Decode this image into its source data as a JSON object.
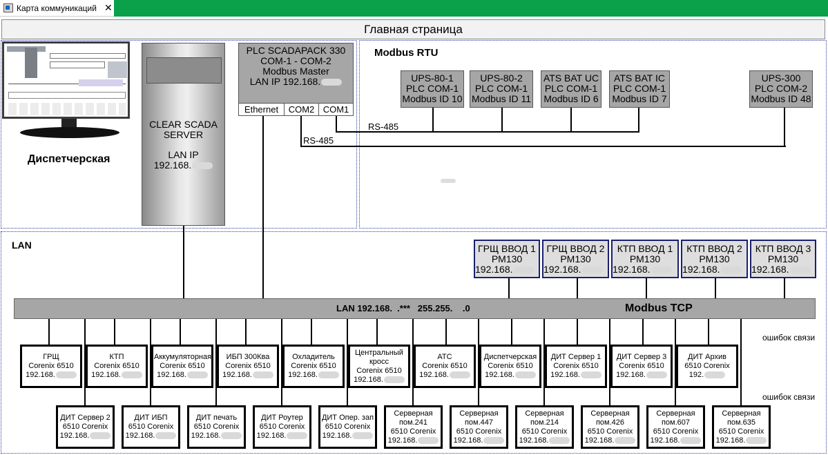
{
  "window": {
    "tab_title": "Карта коммуникаций",
    "close_glyph": "✕"
  },
  "header": {
    "title": "Главная страница"
  },
  "dispatch": {
    "label": "Диспетчерская"
  },
  "server": {
    "line1": "CLEAR SCADA",
    "line2": "SERVER",
    "line3": "LAN IP",
    "ip": "192.168."
  },
  "plc": {
    "line1": "PLC SCADAPACK 330",
    "line2": "COM-1 -  COM-2",
    "line3": "Modbus Master",
    "line4": "LAN IP 192.168.",
    "ports": [
      "Ethernet",
      "COM2",
      "COM1"
    ]
  },
  "rtu": {
    "title": "Modbus RTU",
    "rs485_a": "RS-485",
    "rs485_b": "RS-485",
    "devices": [
      {
        "l1": "UPS-80-1",
        "l2": "PLC COM-1",
        "l3": "Modbus ID 10"
      },
      {
        "l1": "UPS-80-2",
        "l2": "PLC COM-1",
        "l3": "Modbus ID 11"
      },
      {
        "l1": "ATS BAT UC",
        "l2": "PLC COM-1",
        "l3": "Modbus ID 6"
      },
      {
        "l1": "ATS BAT IC",
        "l2": "PLC COM-1",
        "l3": "Modbus ID 7"
      },
      {
        "l1": "UPS-300",
        "l2": "PLC COM-2",
        "l3": "Modbus ID 48"
      }
    ]
  },
  "lan": {
    "title": "LAN",
    "bus_text": "LAN 192.168.  .***   255.255.    .0",
    "bus_tcp": "Modbus TCP",
    "err1": "ошибок связи",
    "err2": "ошибок связи"
  },
  "meters": [
    {
      "l1": "ГРЩ ВВОД 1",
      "l2": "PM130",
      "ip": "192.168."
    },
    {
      "l1": "ГРЩ ВВОД 2",
      "l2": "PM130",
      "ip": "192.168."
    },
    {
      "l1": "КТП ВВОД 1",
      "l2": "PM130",
      "ip": "192.168."
    },
    {
      "l1": "КТП ВВОД 2",
      "l2": "PM130",
      "ip": "192.168."
    },
    {
      "l1": "КТП ВВОД 3",
      "l2": "PM130",
      "ip": "192.168."
    }
  ],
  "row1": [
    {
      "name": "ГРЩ",
      "model": "Corenix 6510",
      "ip": "192.168."
    },
    {
      "name": "КТП",
      "model": "Corenix 6510",
      "ip": "192.168."
    },
    {
      "name": "Аккумуляторная",
      "model": "Corenix 6510",
      "ip": "192.168."
    },
    {
      "name": "ИБП 300Ква",
      "model": "Corenix 6510",
      "ip": "192.168."
    },
    {
      "name": "Охладитель",
      "model": "Corenix 6510",
      "ip": "192.168."
    },
    {
      "name": "Центральный кросс",
      "model": "Corenix 6510",
      "ip": "192.168."
    },
    {
      "name": "АТС",
      "model": "Corenix 6510",
      "ip": "192.168."
    },
    {
      "name": "Диспетчерская",
      "model": "Corenix 6510",
      "ip": "192.168."
    },
    {
      "name": "ДИТ Сервер 1",
      "model": "Corenix 6510",
      "ip": "192.168."
    },
    {
      "name": "ДИТ Сервер 3",
      "model": "Corenix 6510",
      "ip": "192.168."
    },
    {
      "name": "ДИТ Архив",
      "model": "6510 Corenix",
      "ip": "192."
    }
  ],
  "row2": [
    {
      "name": "ДИТ Сервер 2",
      "model": "6510 Corenix",
      "ip": "192.168."
    },
    {
      "name": "ДИТ ИБП",
      "model": "6510 Corenix",
      "ip": "192.168."
    },
    {
      "name": "ДИТ печать",
      "model": "6510 Corenix",
      "ip": "192.168."
    },
    {
      "name": "ДИТ Роутер",
      "model": "6510 Corenix",
      "ip": "192.168."
    },
    {
      "name": "ДИТ Опер. зап",
      "model": "6510 Corenix",
      "ip": "192.168."
    },
    {
      "name": "Серверная пом.241",
      "model": "6510 Corenix",
      "ip": "192.168."
    },
    {
      "name": "Серверная пом.447",
      "model": "6510 Corenix",
      "ip": "192.168."
    },
    {
      "name": "Серверная пом.214",
      "model": "6510 Corenix",
      "ip": "192.168."
    },
    {
      "name": "Серверная пом.426",
      "model": "6510 Corenix",
      "ip": "192.168."
    },
    {
      "name": "Серверная пом.607",
      "model": "6510 Corenix",
      "ip": "192.168."
    },
    {
      "name": "Серверная пом.635",
      "model": "6510 Corenix",
      "ip": "192.168."
    }
  ],
  "colors": {
    "green": "#0aa14a",
    "navy": "#1a1f6e",
    "bus": "#a6a6a6"
  }
}
